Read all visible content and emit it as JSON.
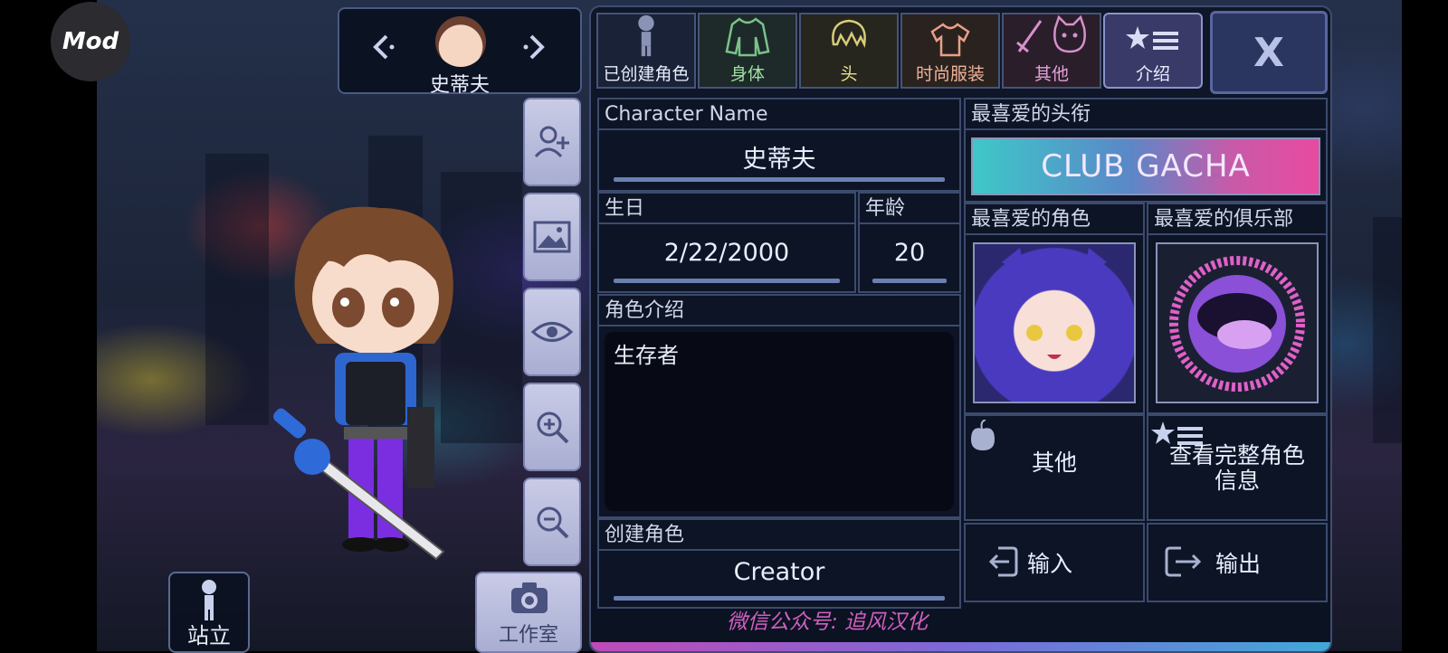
{
  "badge": {
    "label": "Mod"
  },
  "character_selector": {
    "name": "史蒂夫"
  },
  "side_tools": {
    "studio_label": "工作室",
    "stand_label": "站立"
  },
  "tabs": [
    {
      "label": "已创建角色",
      "color": "#e8eefc"
    },
    {
      "label": "身体",
      "color": "#9fe0a0"
    },
    {
      "label": "头",
      "color": "#e8e08a"
    },
    {
      "label": "时尚服装",
      "color": "#f0b39a"
    },
    {
      "label": "其他",
      "color": "#e4a0d8"
    },
    {
      "label": "介绍",
      "color": "#e8eefc"
    }
  ],
  "close_label": "X",
  "profile": {
    "name_label": "Character Name",
    "name_value": "史蒂夫",
    "birthday_label": "生日",
    "birthday_value": "2/22/2000",
    "age_label": "年龄",
    "age_value": "20",
    "intro_label": "角色介绍",
    "intro_value": "生存者",
    "creator_label": "创建角色",
    "creator_value": "Creator"
  },
  "favorites": {
    "title_label": "最喜爱的头衔",
    "title_banner": "CLUB GACHA",
    "character_label": "最喜爱的角色",
    "club_label": "最喜爱的俱乐部"
  },
  "actions": {
    "other": "其他",
    "full_info": "查看完整角色信息",
    "import": "输入",
    "export": "输出"
  },
  "watermark": "微信公众号: 追风汉化"
}
